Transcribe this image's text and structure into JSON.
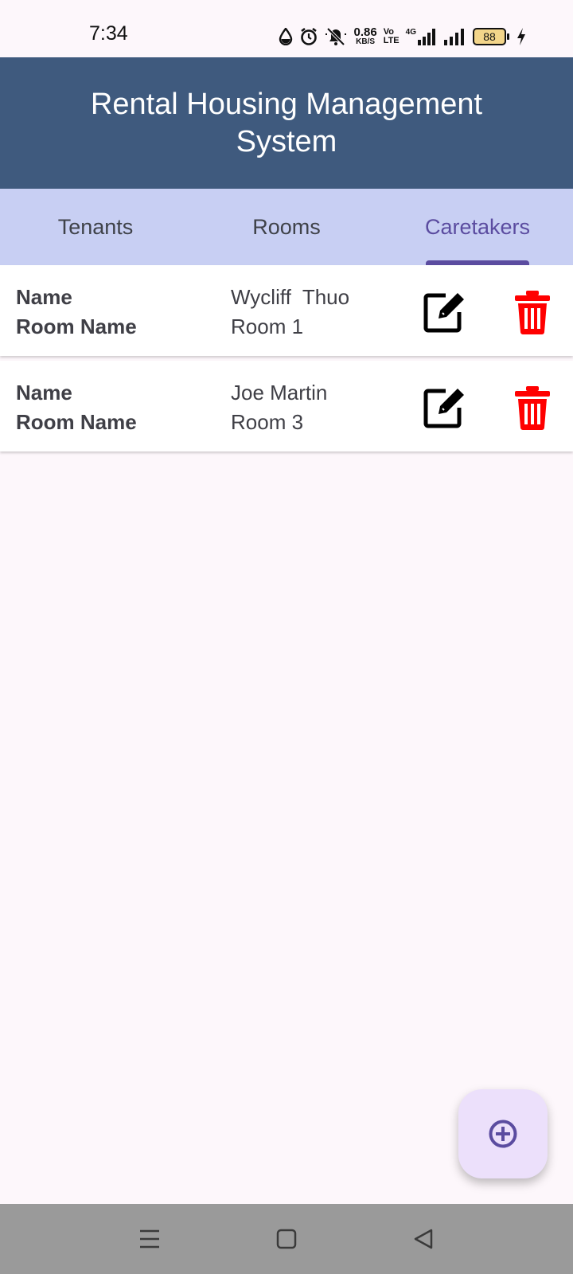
{
  "status_bar": {
    "time": "7:34",
    "speed_value": "0.86",
    "speed_unit": "KB/S",
    "volte_top": "Vo",
    "volte_bottom": "LTE",
    "network": "4G",
    "battery_level": "88",
    "icons": [
      "drop-icon",
      "alarm-icon",
      "mute-bell-icon",
      "signal-icon",
      "signal-icon",
      "battery-icon",
      "charging-icon"
    ]
  },
  "header": {
    "title": "Rental Housing Management System"
  },
  "tabs": [
    {
      "label": "Tenants",
      "active": false
    },
    {
      "label": "Rooms",
      "active": false
    },
    {
      "label": "Caretakers",
      "active": true
    }
  ],
  "caretakers": [
    {
      "name_label": "Name",
      "room_label": "Room Name",
      "name_value": "Wycliff  Thuo",
      "room_value": "Room 1"
    },
    {
      "name_label": "Name",
      "room_label": "Room Name",
      "name_value": "Joe Martin",
      "room_value": "Room 3"
    }
  ],
  "colors": {
    "header_bg": "#3f5a7e",
    "tab_bar_bg": "#c8cff3",
    "active_tab": "#5b4ca0",
    "delete_red": "#ff0000",
    "fab_bg": "#ece0fb",
    "nav_bar_bg": "#9a9a9a"
  },
  "fab": {
    "icon": "add-circle-icon"
  },
  "nav_bar": {
    "icons": [
      "menu-icon",
      "home-square-icon",
      "back-triangle-icon"
    ]
  }
}
